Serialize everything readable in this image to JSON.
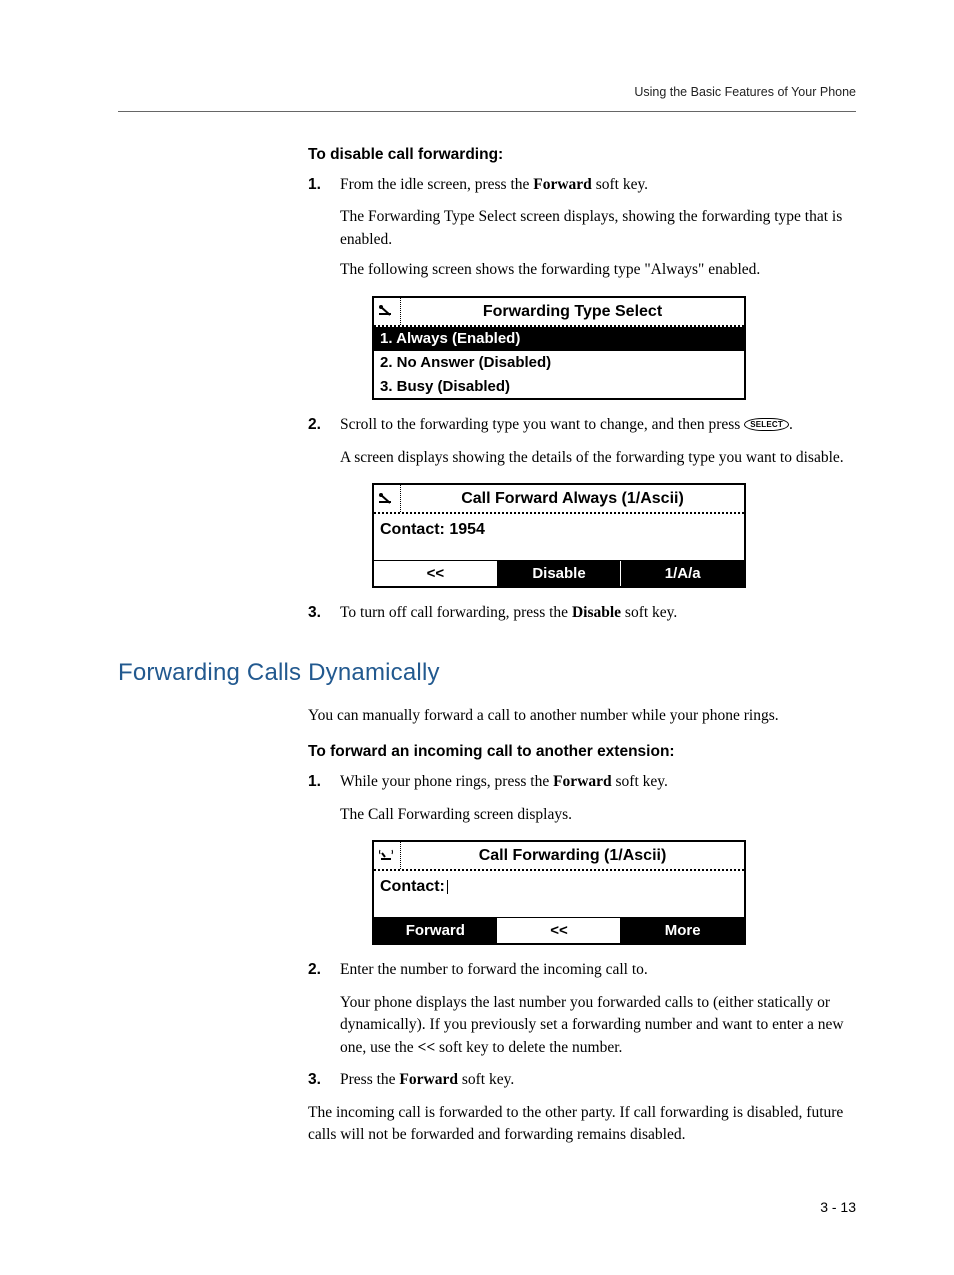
{
  "header": "Using the Basic Features of Your Phone",
  "section1": {
    "title": "To disable call forwarding:",
    "step1_a": "From the idle screen, press the ",
    "step1_b": "Forward",
    "step1_c": " soft key.",
    "step1_p1": "The Forwarding Type Select screen displays, showing the forwarding type that is enabled.",
    "step1_p2": "The following screen shows the forwarding type \"Always\" enabled.",
    "step2_a": "Scroll to the forwarding type you want to change, and then press ",
    "step2_c": ".",
    "step2_p1": "A screen displays showing the details of the forwarding type you want to disable.",
    "step3_a": "To turn off call forwarding, press the ",
    "step3_b": "Disable",
    "step3_c": " soft key.",
    "select_btn": "SELECT"
  },
  "fig1": {
    "title": "Forwarding Type Select",
    "items": [
      "1. Always (Enabled)",
      "2. No Answer (Disabled)",
      "3. Busy (Disabled)"
    ]
  },
  "fig2": {
    "title": "Call Forward Always (1/Ascii)",
    "contact": "Contact: 1954",
    "softkeys": [
      "<<",
      "Disable",
      "1/A/a"
    ]
  },
  "h2": "Forwarding Calls Dynamically",
  "section2": {
    "intro": "You can manually forward a call to another number while your phone rings.",
    "title": "To forward an incoming call to another extension:",
    "step1_a": "While your phone rings, press the ",
    "step1_b": "Forward",
    "step1_c": " soft key.",
    "step1_p1": "The Call Forwarding screen displays.",
    "step2_a": "Enter the number to forward the incoming call to.",
    "step2_p1a": "Your phone displays the last number you forwarded calls to (either statically or dynamically). If you previously set a forwarding number and want to enter a new one, use the ",
    "step2_p1b": "<<",
    "step2_p1c": " soft key to delete the number.",
    "step3_a": "Press the ",
    "step3_b": "Forward",
    "step3_c": " soft key.",
    "outro": "The incoming call is forwarded to the other party. If call forwarding is disabled, future calls will not be forwarded and forwarding remains disabled."
  },
  "fig3": {
    "title": "Call Forwarding (1/Ascii)",
    "contact": "Contact:",
    "softkeys": [
      "Forward",
      "<<",
      "More"
    ]
  },
  "page_number": "3 - 13",
  "chart_data": null
}
